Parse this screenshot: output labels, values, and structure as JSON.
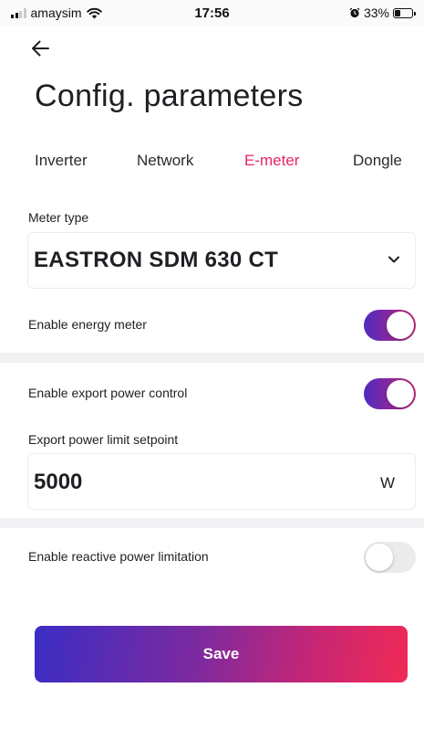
{
  "status_bar": {
    "carrier": "amaysim",
    "time": "17:56",
    "battery": "33%",
    "battery_level": 0.33,
    "icons": [
      "signal-icon",
      "wifi-icon",
      "alarm-icon",
      "battery-icon"
    ]
  },
  "header": {
    "back_icon": "arrow-left-icon",
    "title": "Config. parameters"
  },
  "tabs": [
    {
      "label": "Inverter",
      "active": false
    },
    {
      "label": "Network",
      "active": false
    },
    {
      "label": "E-meter",
      "active": true
    },
    {
      "label": "Dongle",
      "active": false
    }
  ],
  "meter_type": {
    "label": "Meter type",
    "value": "EASTRON SDM 630 CT",
    "icon": "chevron-down-icon"
  },
  "enable_energy_meter": {
    "label": "Enable energy meter",
    "on": true
  },
  "enable_export_power_control": {
    "label": "Enable export power control",
    "on": true
  },
  "export_power_limit": {
    "label": "Export power limit setpoint",
    "value": "5000",
    "unit": "W"
  },
  "enable_reactive_power_limitation": {
    "label": "Enable reactive power limitation",
    "on": false
  },
  "save_label": "Save",
  "colors": {
    "accent_active_tab": "#e8246c",
    "toggle_gradient_start": "#4f2ac0",
    "toggle_gradient_end": "#c4256e",
    "button_gradient_start": "#3a2dc4",
    "button_gradient_end": "#f02a55"
  }
}
